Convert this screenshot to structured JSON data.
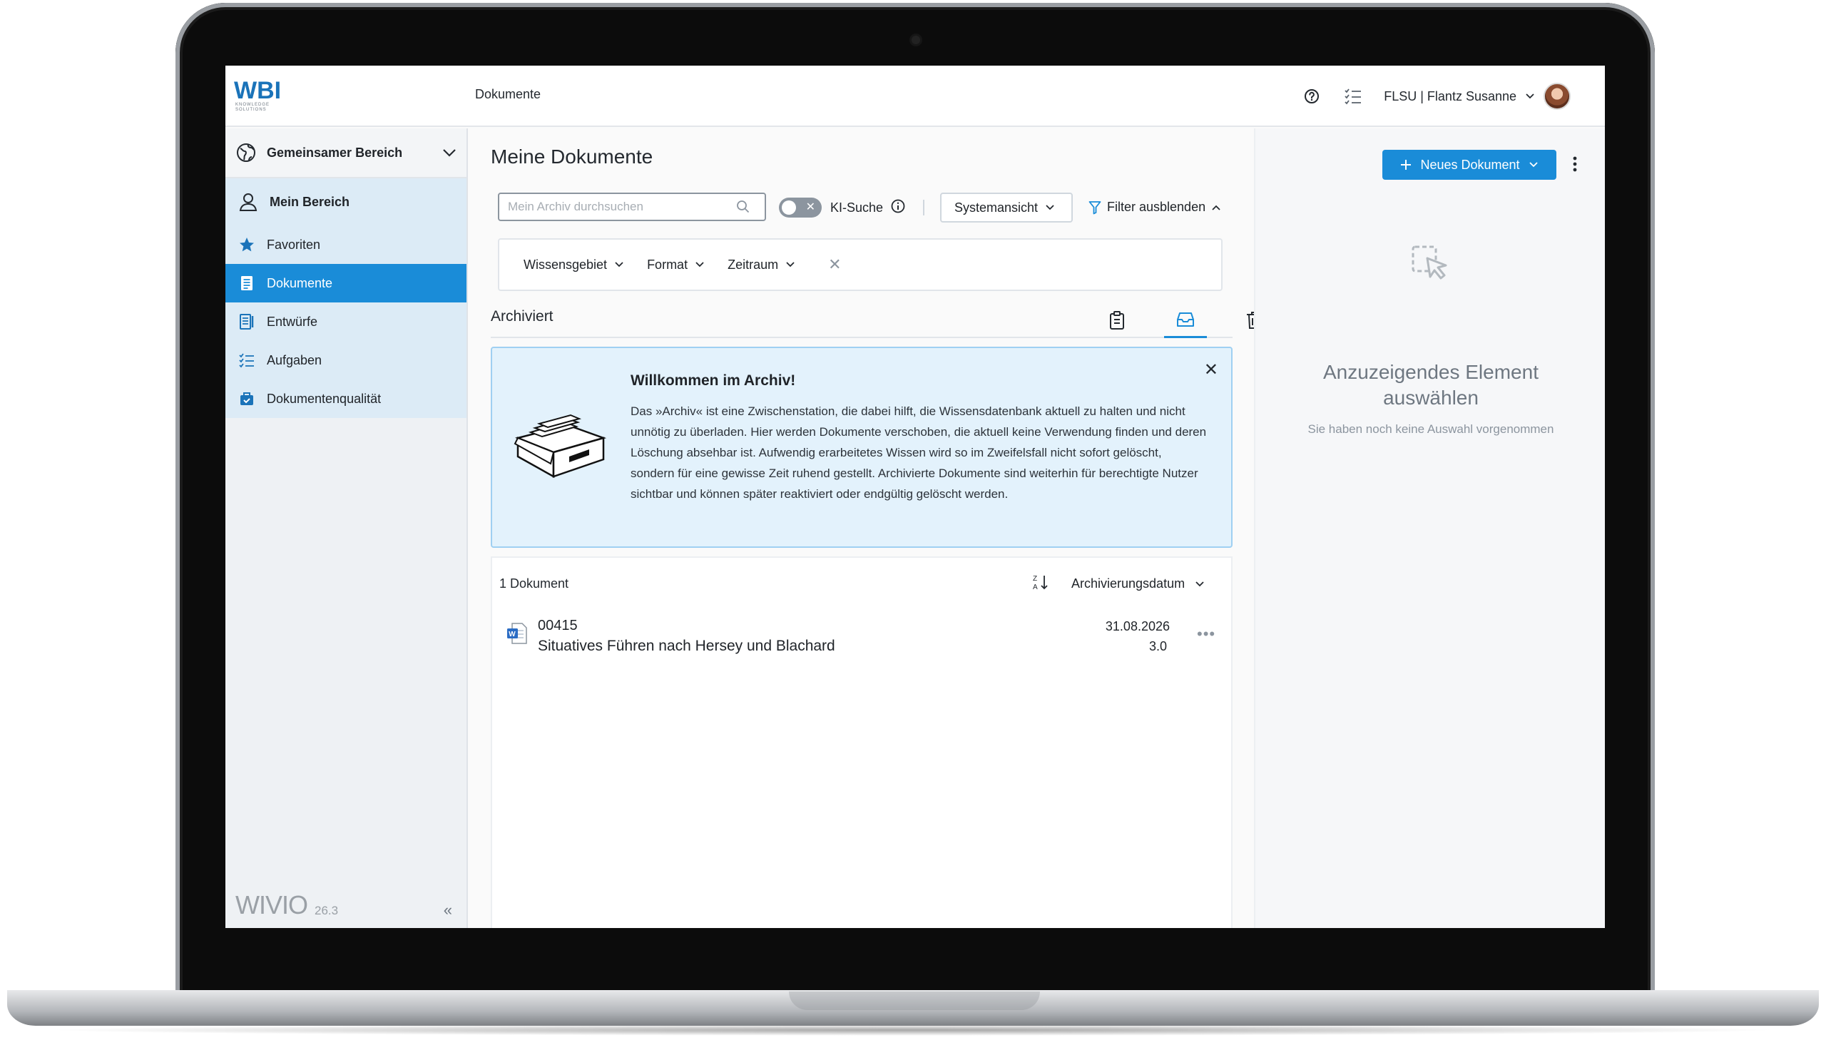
{
  "app": {
    "logo_text": "WBI",
    "logo_subtext": "KNOWLEDGE SOLUTIONS",
    "breadcrumb": "Dokumente",
    "user_label": "FLSU | Flantz Susanne",
    "accent_color": "#1a8cd8"
  },
  "sidebar": {
    "workspace_label": "Gemeinsamer Bereich",
    "items": [
      {
        "label": "Mein Bereich",
        "icon": "user-icon"
      },
      {
        "label": "Favoriten",
        "icon": "star-icon"
      },
      {
        "label": "Dokumente",
        "icon": "document-icon",
        "active": true
      },
      {
        "label": "Entwürfe",
        "icon": "draft-icon"
      },
      {
        "label": "Aufgaben",
        "icon": "tasks-icon"
      },
      {
        "label": "Dokumentenqualität",
        "icon": "quality-icon"
      }
    ],
    "brand": "WIVIO",
    "version": "26.3"
  },
  "main": {
    "title": "Meine Dokumente",
    "search_placeholder": "Mein Archiv durchsuchen",
    "ai_search_label": "KI-Suche",
    "view_select": "Systemansicht",
    "filter_toggle_label": "Filter ausblenden",
    "filters": [
      "Wissensgebiet",
      "Format",
      "Zeitraum"
    ],
    "tab_title": "Archiviert",
    "welcome": {
      "title": "Willkommen im Archiv!",
      "text": "Das »Archiv« ist eine Zwischenstation, die dabei hilft, die Wissensdatenbank aktuell zu halten und nicht unnötig zu überladen. Hier werden Dokumente verschoben, die aktuell keine Verwendung finden und deren Löschung absehbar ist. Aufwendig erarbeitetes Wissen wird so im Zweifelsfall nicht sofort gelöscht, sondern für eine gewisse Zeit ruhend gestellt. Archivierte Dokumente sind weiterhin für berechtigte Nutzer sichtbar und können später reaktiviert oder endgültig gelöscht werden."
    },
    "list": {
      "count_label": "1 Dokument",
      "sort_label": "Archivierungsdatum",
      "documents": [
        {
          "id": "00415",
          "title": "Situatives Führen nach Hersey und Blachard",
          "date": "31.08.2026",
          "version": "3.0"
        }
      ]
    }
  },
  "right_panel": {
    "new_button_label": "Neues Dokument",
    "empty_title": "Anzuzeigendes Element auswählen",
    "empty_subtitle": "Sie haben noch keine Auswahl vorgenommen"
  }
}
